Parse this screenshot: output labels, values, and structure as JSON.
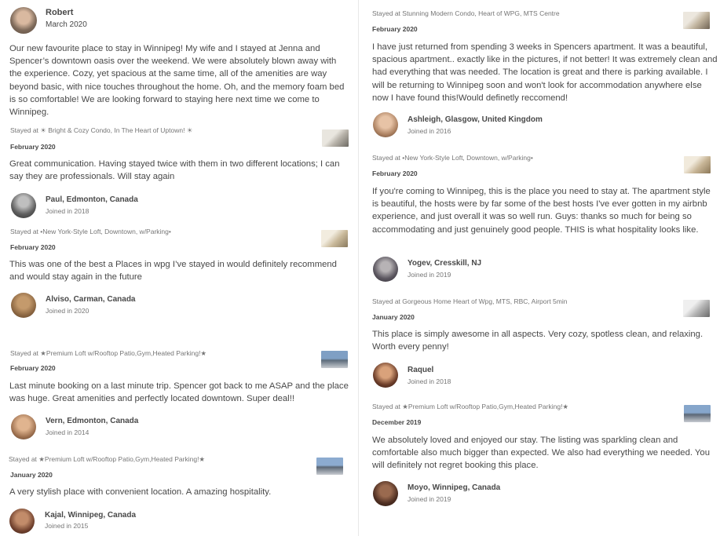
{
  "reviews_left": [
    {
      "name": "Robert",
      "date": "March 2020",
      "text": "Our new favourite place to stay in Winnipeg! My wife and I stayed at Jenna and Spencer’s downtown oasis over the weekend. We were absolutely blown away with the experience. Cozy, yet spacious at the same time, all of the amenities are way beyond basic, with nice touches throughout the home. Oh, and the memory foam bed is so comfortable! We are looking forward to staying here next time we come to Winnipeg."
    },
    {
      "stayed": "Stayed at ☀ Bright & Cozy Condo, In The Heart of Uptown! ☀",
      "date": "February 2020",
      "text": "Great communication. Having stayed twice with them in two different locations; I can say they are professionals. Will stay again",
      "name": "Paul, Edmonton, Canada",
      "joined": "Joined in 2018"
    },
    {
      "stayed": "Stayed at •New York-Style Loft, Downtown, w/Parking•",
      "date": "February 2020",
      "text": "This was one of the best a Places in wpg I’ve stayed in would definitely recommend and would stay again in the future",
      "name": "Alviso, Carman, Canada",
      "joined": "Joined in 2020"
    },
    {
      "stayed": "Stayed at ★Premium Loft w/Rooftop Patio,Gym,Heated Parking!★",
      "date": "February 2020",
      "text": "Last minute booking on a last minute trip. Spencer got back to me ASAP and the place was huge. Great amenities and perfectly located downtown. Super deal!!",
      "name": "Vern, Edmonton, Canada",
      "joined": "Joined in 2014"
    },
    {
      "stayed": "Stayed at ★Premium Loft w/Rooftop Patio,Gym,Heated Parking!★",
      "date": "January 2020",
      "text": "A very stylish place with convenient location. A amazing hospitality.",
      "name": "Kajal, Winnipeg, Canada",
      "joined": "Joined in 2015"
    }
  ],
  "reviews_right": [
    {
      "stayed": "Stayed at Stunning Modern Condo, Heart of WPG, MTS Centre",
      "date": "February 2020",
      "text": "I have just returned from spending 3 weeks in Spencers apartment. It was a beautiful, spacious apartment.. exactly like in the pictures, if not better! It was extremely clean and had everything that was needed. The location is great and there is parking available. I will be returning to Winnipeg soon and won't look for accommodation anywhere else now I have found this!Would definetly reccomend!",
      "name": "Ashleigh, Glasgow, United Kingdom",
      "joined": "Joined in 2016"
    },
    {
      "stayed": "Stayed at •New York-Style Loft, Downtown, w/Parking•",
      "date": "February 2020",
      "text": "If you're coming to Winnipeg, this is the place you need to stay at. The apartment style is beautiful, the hosts were by far some of the best hosts I've ever gotten in my airbnb experience, and just overall it was so well run. Guys: thanks so much for being so accommodating and just genuinely good people. THIS is what hospitality looks like.",
      "name": "Yogev, Cresskill, NJ",
      "joined": "Joined in 2019"
    },
    {
      "stayed": "Stayed at Gorgeous Home Heart of Wpg, MTS, RBC, Airport 5min",
      "date": "January 2020",
      "text": "This place is simply awesome in all aspects. Very cozy, spotless clean, and relaxing. Worth every penny!",
      "name": "Raquel",
      "joined": "Joined in 2018"
    },
    {
      "stayed": "Stayed at ★Premium Loft w/Rooftop Patio,Gym,Heated Parking!★",
      "date": "December 2019",
      "text": "We absolutely loved and enjoyed our stay. The listing was sparkling clean and comfortable also much bigger than expected. We also had everything we needed. You will definitely not regret booking this place.",
      "name": "Moyo, Winnipeg, Canada",
      "joined": "Joined in 2019"
    }
  ]
}
